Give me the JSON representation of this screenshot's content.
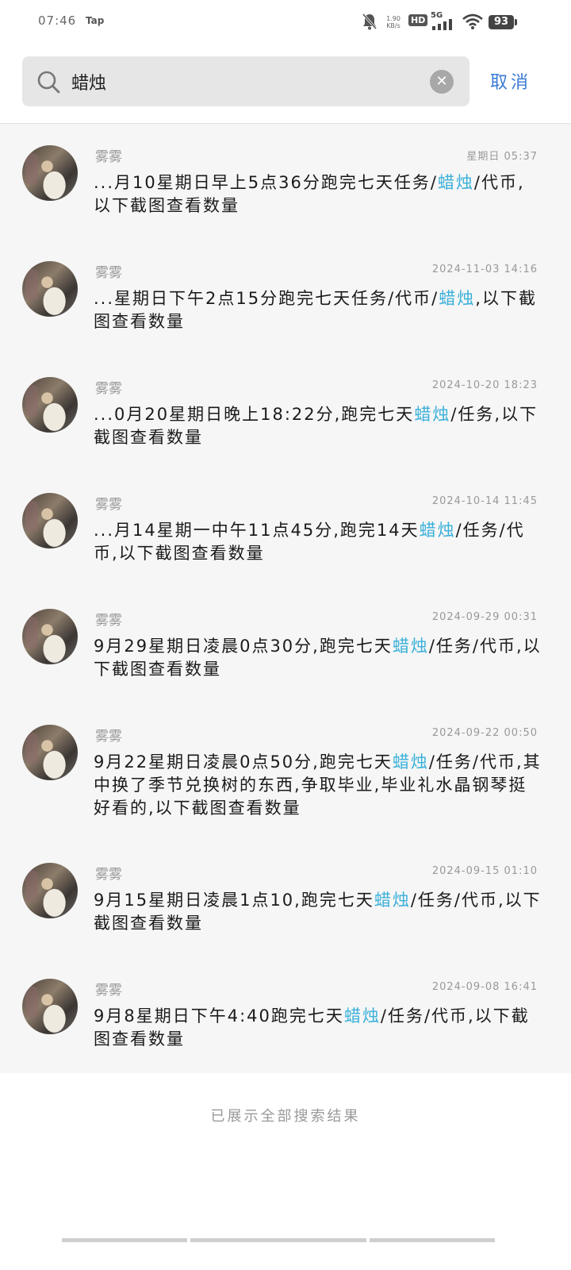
{
  "status_bar": {
    "time": "07:46",
    "app_badge": "Tap",
    "net_speed_top": "1.90",
    "net_speed_unit": "KB/s",
    "hd_label": "HD",
    "network_label": "5G",
    "battery": "93",
    "icons": [
      "mute-bell-icon",
      "wifi-icon"
    ]
  },
  "search": {
    "query": "蜡烛",
    "cancel_label": "取消"
  },
  "highlight_color": "#3ab0d9",
  "results": [
    {
      "author": "雾雾",
      "time": "星期日 05:37",
      "pre": "...月10星期日早上5点36分跑完七天任务/",
      "hit": "蜡烛",
      "post": "/代币,以下截图查看数量"
    },
    {
      "author": "雾雾",
      "time": "2024-11-03 14:16",
      "pre": "...星期日下午2点15分跑完七天任务/代币/",
      "hit": "蜡烛",
      "post": ",以下截图查看数量"
    },
    {
      "author": "雾雾",
      "time": "2024-10-20 18:23",
      "pre": "...0月20星期日晚上18:22分,跑完七天",
      "hit": "蜡烛",
      "post": "/任务,以下截图查看数量"
    },
    {
      "author": "雾雾",
      "time": "2024-10-14 11:45",
      "pre": "...月14星期一中午11点45分,跑完14天",
      "hit": "蜡烛",
      "post": "/任务/代币,以下截图查看数量"
    },
    {
      "author": "雾雾",
      "time": "2024-09-29 00:31",
      "pre": "9月29星期日凌晨0点30分,跑完七天",
      "hit": "蜡烛",
      "post": "/任务/代币,以下截图查看数量"
    },
    {
      "author": "雾雾",
      "time": "2024-09-22 00:50",
      "pre": "9月22星期日凌晨0点50分,跑完七天",
      "hit": "蜡烛",
      "post": "/任务/代币,其中换了季节兑换树的东西,争取毕业,毕业礼水晶钢琴挺好看的,以下截图查看数量"
    },
    {
      "author": "雾雾",
      "time": "2024-09-15 01:10",
      "pre": "9月15星期日凌晨1点10,跑完七天",
      "hit": "蜡烛",
      "post": "/任务/代币,以下截图查看数量"
    },
    {
      "author": "雾雾",
      "time": "2024-09-08 16:41",
      "pre": "9月8星期日下午4:40跑完七天",
      "hit": "蜡烛",
      "post": "/任务/代币,以下截图查看数量"
    }
  ],
  "footer": {
    "end_text": "已展示全部搜索结果"
  }
}
